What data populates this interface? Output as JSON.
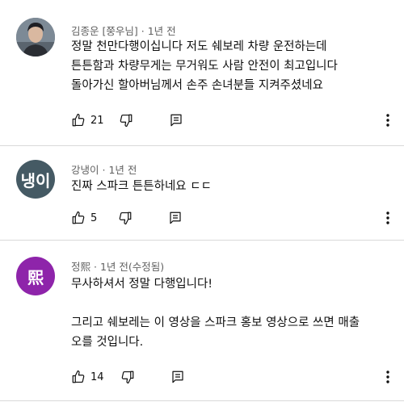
{
  "comments": [
    {
      "author": "김종운",
      "badge": "[쭝우님]",
      "time": "· 1년 전",
      "avatar": {
        "type": "photo",
        "bg": "#6f7884"
      },
      "lines": [
        "정말 천만다행이십니다 저도 쉐보레 차량 운전하는데",
        "튼튼함과 차량무게는 무거워도 사람 안전이 최고입니다",
        "돌아가신 할아버님께서 손주 손녀분들 지켜주셨네요"
      ],
      "likes": "21"
    },
    {
      "author": "강냉이",
      "badge": "",
      "time": "· 1년 전",
      "avatar": {
        "type": "text",
        "text": "냉이",
        "bg": "#455a64"
      },
      "lines": [
        "진짜 스파크 튼튼하네요 ㄷㄷ"
      ],
      "likes": "5"
    },
    {
      "author": "정熙",
      "badge": "",
      "time": "· 1년 전(수정됨)",
      "avatar": {
        "type": "text",
        "text": "熙",
        "bg": "#8e24aa"
      },
      "lines": [
        "무사하셔서 정말 다행입니다!",
        "",
        "그리고 쉐보레는 이 영상을 스파크 홍보 영상으로 쓰면 매출",
        "오를 것입니다."
      ],
      "likes": "14"
    }
  ]
}
